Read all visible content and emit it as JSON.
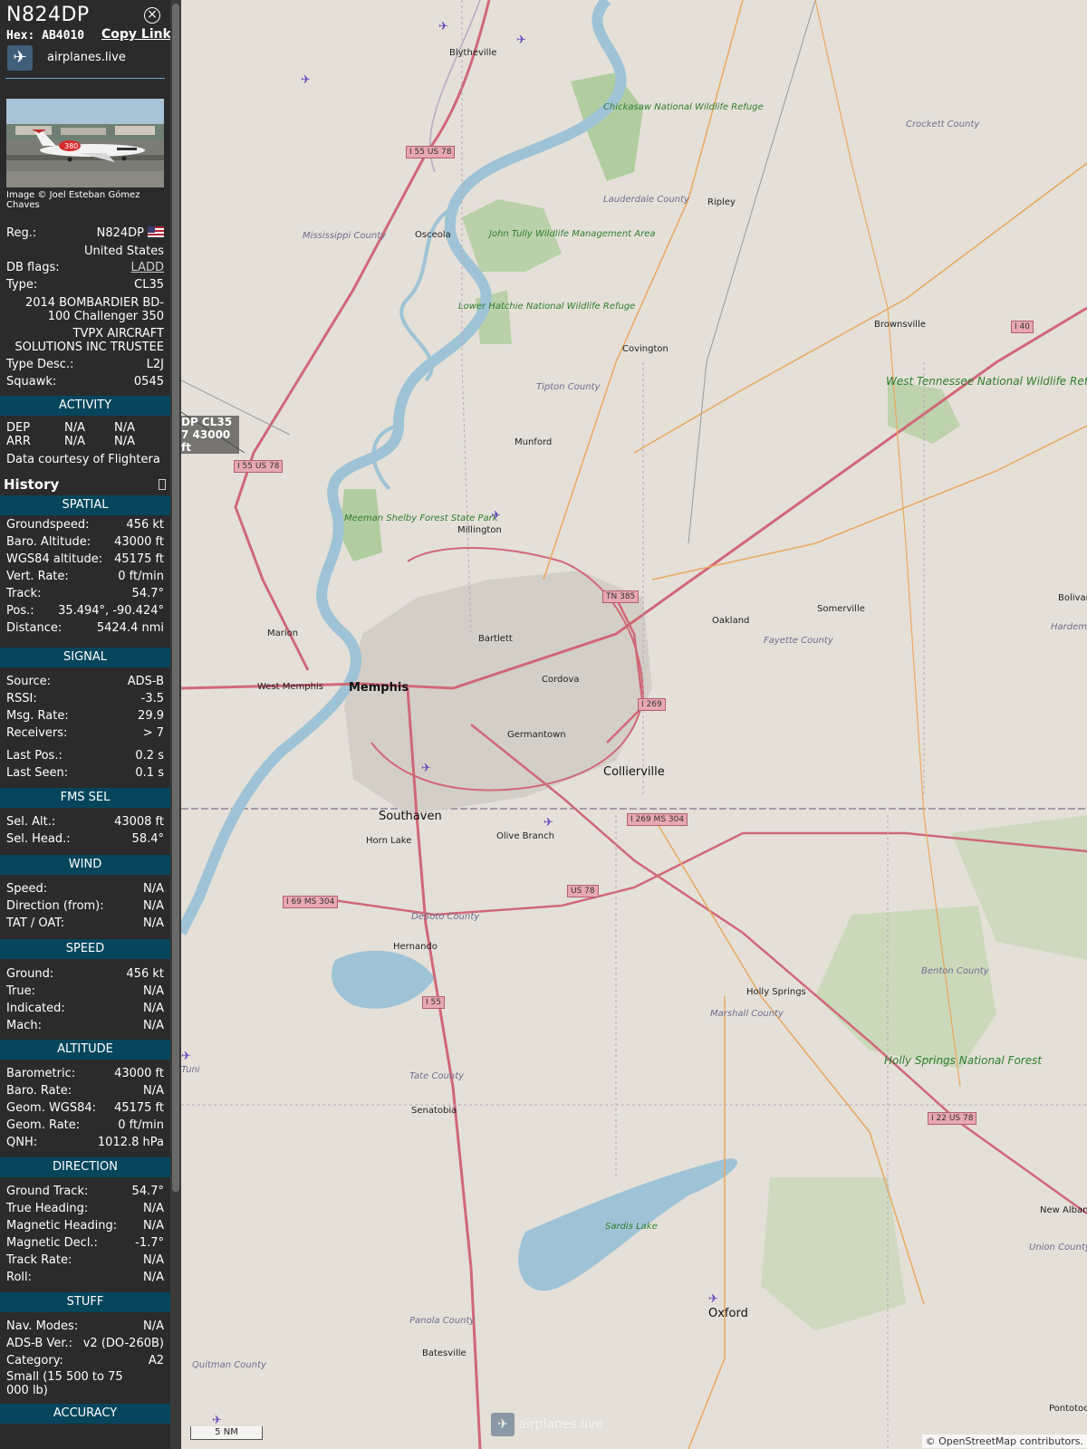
{
  "header": {
    "registration": "N824DP",
    "hex_label": "Hex:",
    "hex": "AB4010",
    "copy_link": "Copy Link",
    "site": "airplanes.live"
  },
  "photo_credit": "Image © Joel Esteban Gómez Chaves",
  "info": {
    "reg_label": "Reg.:",
    "reg_value": "N824DP",
    "country": "United States",
    "dbflags_label": "DB flags:",
    "dbflags_value": "LADD",
    "type_label": "Type:",
    "type_value": "CL35",
    "type_full": "2014 BOMBARDIER BD-100 Challenger 350",
    "operator": "TVPX AIRCRAFT SOLUTIONS INC TRUSTEE",
    "typedesc_label": "Type Desc.:",
    "typedesc_value": "L2J",
    "squawk_label": "Squawk:",
    "squawk_value": "0545"
  },
  "activity": {
    "title": "ACTIVITY",
    "dep_label": "DEP",
    "dep_a": "N/A",
    "dep_b": "N/A",
    "arr_label": "ARR",
    "arr_a": "N/A",
    "arr_b": "N/A",
    "courtesy_prefix": "Data courtesy of",
    "courtesy_name": "Flightera"
  },
  "history_label": "History",
  "sections": {
    "spatial": "SPATIAL",
    "signal": "SIGNAL",
    "fms": "FMS SEL",
    "wind": "WIND",
    "speed": "SPEED",
    "altitude": "ALTITUDE",
    "direction": "DIRECTION",
    "stuff": "STUFF",
    "accuracy": "ACCURACY"
  },
  "spatial": [
    {
      "k": "Groundspeed:",
      "v": "456 kt"
    },
    {
      "k": "Baro. Altitude:",
      "v": "43000 ft"
    },
    {
      "k": "WGS84 altitude:",
      "v": "45175 ft"
    },
    {
      "k": "Vert. Rate:",
      "v": "0 ft/min"
    },
    {
      "k": "Track:",
      "v": "54.7°"
    },
    {
      "k": "Pos.:",
      "v": "35.494°, -90.424°"
    },
    {
      "k": "Distance:",
      "v": "5424.4 nmi"
    }
  ],
  "signal": [
    {
      "k": "Source:",
      "v": "ADS-B"
    },
    {
      "k": "RSSI:",
      "v": "-3.5"
    },
    {
      "k": "Msg. Rate:",
      "v": "29.9"
    },
    {
      "k": "Receivers:",
      "v": "> 7"
    },
    {
      "k": "Last Pos.:",
      "v": "0.2 s"
    },
    {
      "k": "Last Seen:",
      "v": "0.1 s"
    }
  ],
  "fms": [
    {
      "k": "Sel. Alt.:",
      "v": "43008 ft"
    },
    {
      "k": "Sel. Head.:",
      "v": "58.4°"
    }
  ],
  "wind": [
    {
      "k": "Speed:",
      "v": "N/A"
    },
    {
      "k": "Direction (from):",
      "v": "N/A"
    },
    {
      "k": "TAT / OAT:",
      "v": "N/A"
    }
  ],
  "speed": [
    {
      "k": "Ground:",
      "v": "456 kt"
    },
    {
      "k": "True:",
      "v": "N/A"
    },
    {
      "k": "Indicated:",
      "v": "N/A"
    },
    {
      "k": "Mach:",
      "v": "N/A"
    }
  ],
  "altitude": [
    {
      "k": "Barometric:",
      "v": "43000 ft"
    },
    {
      "k": "Baro. Rate:",
      "v": "N/A"
    },
    {
      "k": "Geom. WGS84:",
      "v": "45175 ft"
    },
    {
      "k": "Geom. Rate:",
      "v": "0 ft/min"
    },
    {
      "k": "QNH:",
      "v": "1012.8 hPa"
    }
  ],
  "direction": [
    {
      "k": "Ground Track:",
      "v": "54.7°"
    },
    {
      "k": "True Heading:",
      "v": "N/A"
    },
    {
      "k": "Magnetic Heading:",
      "v": "N/A"
    },
    {
      "k": "Magnetic Decl.:",
      "v": "-1.7°"
    },
    {
      "k": "Track Rate:",
      "v": "N/A"
    },
    {
      "k": "Roll:",
      "v": "N/A"
    }
  ],
  "stuff": [
    {
      "k": "Nav. Modes:",
      "v": "N/A"
    },
    {
      "k": "ADS-B Ver.:",
      "v": "v2 (DO-260B)"
    },
    {
      "k": "Category:",
      "v": "A2"
    }
  ],
  "category_desc": "Small (15 500 to 75 000 lb)",
  "map": {
    "aircraft_label_lines": [
      "DP CL35",
      "7 43000 ft",
      "DP"
    ],
    "cities": [
      {
        "name": "Memphis",
        "big": true
      },
      {
        "name": "West Memphis"
      },
      {
        "name": "Marion"
      },
      {
        "name": "Bartlett"
      },
      {
        "name": "Cordova"
      },
      {
        "name": "Germantown"
      },
      {
        "name": "Collierville",
        "big": true
      },
      {
        "name": "Southaven",
        "big": true
      },
      {
        "name": "Horn Lake"
      },
      {
        "name": "Olive Branch"
      },
      {
        "name": "Hernando"
      },
      {
        "name": "Senatobia"
      },
      {
        "name": "Batesville"
      },
      {
        "name": "Oxford",
        "big": true
      },
      {
        "name": "Holly Springs"
      },
      {
        "name": "Millington"
      },
      {
        "name": "Munford"
      },
      {
        "name": "Covington"
      },
      {
        "name": "Osceola"
      },
      {
        "name": "Blytheville"
      },
      {
        "name": "Ripley"
      },
      {
        "name": "Brownsville"
      },
      {
        "name": "Somerville"
      },
      {
        "name": "Oakland"
      },
      {
        "name": "New Albany"
      },
      {
        "name": "Pontotoc"
      },
      {
        "name": "Bolivar"
      }
    ],
    "counties": [
      "Mississippi County",
      "Lauderdale County",
      "Crockett County",
      "Tipton County",
      "Fayette County",
      "DeSoto County",
      "Marshall County",
      "Benton County",
      "Tate County",
      "Panola County",
      "Quitman County",
      "Union County",
      "Hardeman County",
      "Tunica County"
    ],
    "parks": [
      "Chickasaw National Wildlife Refuge",
      "John Tully Wildlife Management Area",
      "Lower Hatchie National Wildlife Refuge",
      "Meeman Shelby Forest State Park",
      "Sardis Lake"
    ],
    "parks_big": [
      "West Tennessee National Wildlife Refuge Complex",
      "Holly Springs National Forest"
    ],
    "shields": [
      "I 55 US 78",
      "I 55 US 78",
      "TN 385",
      "I 269",
      "I 269 MS 304",
      "US 78",
      "I 69 MS 304",
      "I 55",
      "I 40",
      "I 22 US 78"
    ],
    "scale": "5 NM",
    "attribution": "© OpenStreetMap contributors.",
    "watermark": "airplanes.live"
  },
  "colors": {
    "sidebar_bg": "#2b2b2b",
    "section_bg": "#06465c",
    "river": "#9fc3d6",
    "road_major": "#d06878",
    "road_minor": "#e8a860",
    "park": "#8fc07a",
    "plane": "#6a4ec0"
  }
}
